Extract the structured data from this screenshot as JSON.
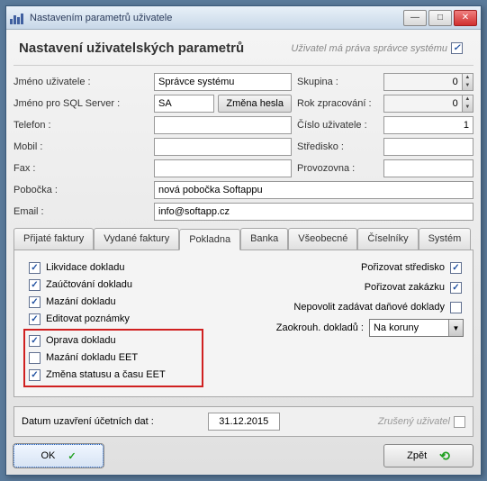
{
  "window": {
    "title": "Nastavením parametrů uživatele"
  },
  "header": {
    "title": "Nastavení uživatelských parametrů",
    "rights_label": "Uživatel má práva správce systému"
  },
  "fields": {
    "username_label": "Jméno uživatele :",
    "username_value": "Správce systému",
    "sqlname_label": "Jméno pro SQL Server :",
    "sqlname_value": "SA",
    "change_password_btn": "Změna hesla",
    "phone_label": "Telefon :",
    "phone_value": "",
    "mobile_label": "Mobil :",
    "mobile_value": "",
    "fax_label": "Fax :",
    "fax_value": "",
    "branch_label": "Pobočka :",
    "branch_value": "nová pobočka Softappu",
    "email_label": "Email :",
    "email_value": "info@softapp.cz",
    "group_label": "Skupina :",
    "group_value": "0",
    "year_label": "Rok zpracování :",
    "year_value": "0",
    "userno_label": "Číslo uživatele :",
    "userno_value": "1",
    "center_label": "Středisko :",
    "center_value": "",
    "establishment_label": "Provozovna :",
    "establishment_value": ""
  },
  "tabs": {
    "received": "Přijaté faktury",
    "issued": "Vydané faktury",
    "cash": "Pokladna",
    "bank": "Banka",
    "general": "Všeobecné",
    "lists": "Číselníky",
    "system": "Systém"
  },
  "pokladna": {
    "left": [
      {
        "label": "Likvidace dokladu",
        "checked": true
      },
      {
        "label": "Zaúčtování dokladu",
        "checked": true
      },
      {
        "label": "Mazání dokladu",
        "checked": true
      },
      {
        "label": "Editovat poznámky",
        "checked": true
      },
      {
        "label": "Oprava dokladu",
        "checked": true
      },
      {
        "label": "Mazání dokladu EET",
        "checked": false
      },
      {
        "label": "Změna statusu a času EET",
        "checked": true
      }
    ],
    "right": {
      "center_label": "Pořizovat středisko",
      "center_checked": true,
      "order_label": "Pořizovat zakázku",
      "order_checked": true,
      "notax_label": "Nepovolit zadávat daňové doklady",
      "notax_checked": false,
      "round_label": "Zaokrouh. dokladů :",
      "round_value": "Na koruny"
    }
  },
  "footer": {
    "date_label": "Datum uzavření účetních dat :",
    "date_value": "31.12.2015",
    "cancelled_label": "Zrušený uživatel",
    "ok_btn": "OK",
    "back_btn": "Zpět"
  }
}
